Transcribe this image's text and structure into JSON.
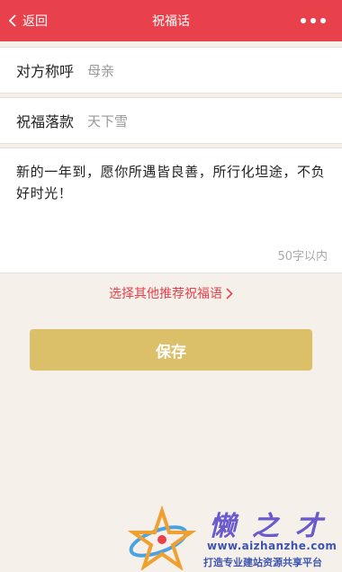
{
  "navbar": {
    "back_label": "返回",
    "title": "祝福话",
    "bg_color": "#e8414c"
  },
  "form": {
    "recipient": {
      "label": "对方称呼",
      "value": "母亲"
    },
    "signature": {
      "label": "祝福落款",
      "value": "天下雪"
    },
    "message": {
      "value": "新的一年到，愿你所遇皆良善，所行化坦途，不负好时光！",
      "limit_hint": "50字以内"
    }
  },
  "recommend_link": "选择其他推荐祝福语",
  "save_button": {
    "label": "保存",
    "color": "#dcbf69"
  },
  "watermark": {
    "brand": "懒之才",
    "url": "www.aizhanzhe.com",
    "slogan": "打造专业建站资源共享平台"
  },
  "icons": {
    "back": "chevron-left-icon",
    "more": "more-dots-icon",
    "recommend": "chevron-right-icon"
  }
}
